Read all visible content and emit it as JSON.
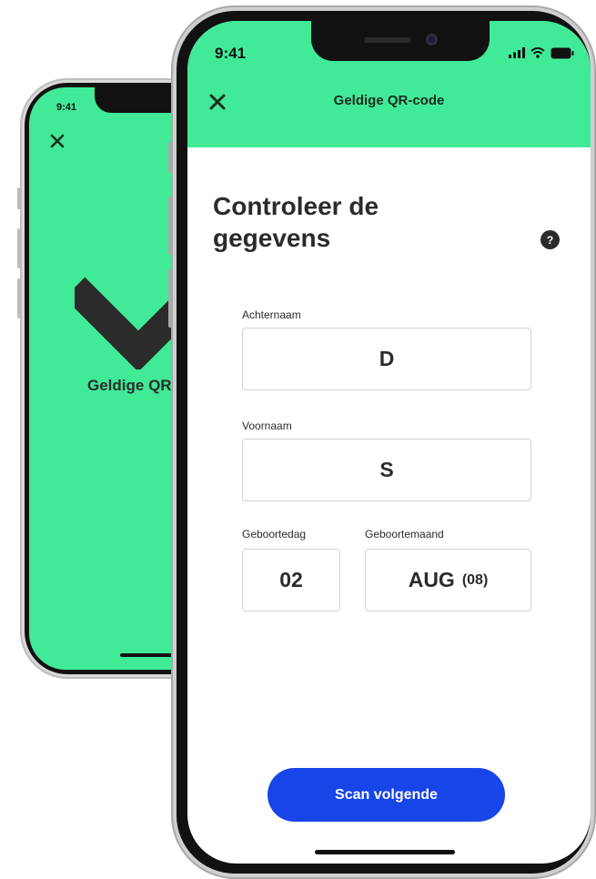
{
  "back_phone": {
    "time": "9:41",
    "title": "Geldige QR-code",
    "screen_color": "#40ea97"
  },
  "front_phone": {
    "status_bar": {
      "time": "9:41"
    },
    "header": {
      "title": "Geldige QR-code",
      "close_icon": "close-icon",
      "background": "#40ea97"
    },
    "page_title": "Controleer de gegevens",
    "help_icon": {
      "glyph": "?"
    },
    "fields": {
      "achternaam": {
        "label": "Achternaam",
        "value": "D"
      },
      "voornaam": {
        "label": "Voornaam",
        "value": "S"
      },
      "geboortedag": {
        "label": "Geboortedag",
        "value": "02"
      },
      "geboortemaand": {
        "label": "Geboortemaand",
        "value": "AUG",
        "value_suffix": "(08)"
      }
    },
    "scan_button": {
      "label": "Scan volgende",
      "color": "#1845e8"
    }
  }
}
